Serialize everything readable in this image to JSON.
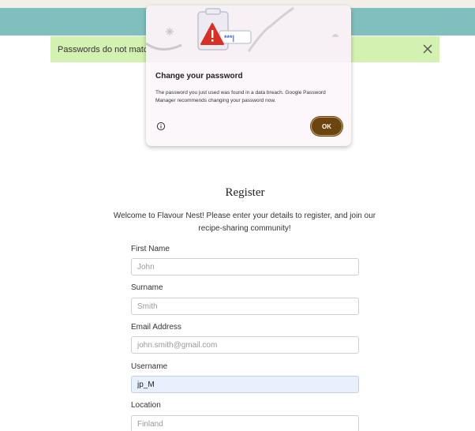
{
  "alert": {
    "message": "Passwords do not match."
  },
  "popup": {
    "title": "Change your password",
    "description": "The password you just used was found in a data breach. Google Password Manager recommends changing your password now.",
    "ok_label": "OK",
    "masked_password": "***|"
  },
  "register": {
    "title": "Register",
    "intro": "Welcome to Flavour Nest! Please enter your details to register, and join our recipe-sharing community!"
  },
  "form": {
    "first_name": {
      "label": "First Name",
      "placeholder": "John",
      "value": ""
    },
    "surname": {
      "label": "Surname",
      "placeholder": "Smith",
      "value": ""
    },
    "email": {
      "label": "Email Address",
      "placeholder": "john.smith@gmail.com",
      "value": ""
    },
    "username": {
      "label": "Username",
      "placeholder": "",
      "value": "jp_M"
    },
    "location": {
      "label": "Location",
      "placeholder": "Finland",
      "value": ""
    }
  },
  "colors": {
    "header": "#7fbfbd",
    "alert_bg": "#d3f1b0",
    "ok_button": "#6b4410",
    "warning_red": "#d93025",
    "autofill_bg": "#e8effd"
  }
}
